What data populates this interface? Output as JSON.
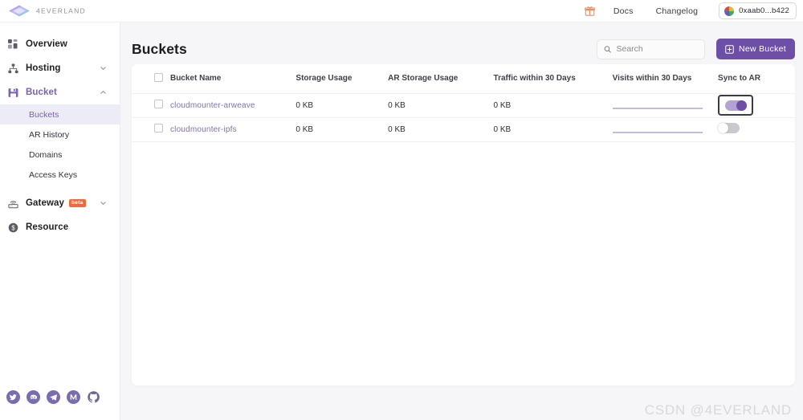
{
  "brand": {
    "name": "4EVERLAND",
    "logo_icon": "diamond-logo-icon"
  },
  "topbar": {
    "gift_icon": "gift-icon",
    "links": [
      {
        "label": "Docs",
        "name": "docs-link"
      },
      {
        "label": "Changelog",
        "name": "changelog-link"
      }
    ],
    "wallet": {
      "address": "0xaab0...b422",
      "avatar_icon": "wallet-avatar-icon"
    }
  },
  "sidebar": {
    "items": [
      {
        "label": "Overview",
        "icon": "grid-dashboard-icon",
        "expandable": false,
        "active": false
      },
      {
        "label": "Hosting",
        "icon": "sitemap-network-icon",
        "expandable": true,
        "expanded": false,
        "active": false
      },
      {
        "label": "Bucket",
        "icon": "floppy-save-icon",
        "expandable": true,
        "expanded": true,
        "active": true
      },
      {
        "label": "Gateway",
        "icon": "router-wifi-icon",
        "expandable": true,
        "expanded": false,
        "active": false,
        "badge": "beta"
      },
      {
        "label": "Resource",
        "icon": "dollar-coin-icon",
        "expandable": false,
        "active": false
      }
    ],
    "bucket_subitems": [
      {
        "label": "Buckets",
        "selected": true
      },
      {
        "label": "AR History",
        "selected": false
      },
      {
        "label": "Domains",
        "selected": false
      },
      {
        "label": "Access Keys",
        "selected": false
      }
    ],
    "socials": [
      {
        "name": "twitter-icon"
      },
      {
        "name": "discord-icon"
      },
      {
        "name": "telegram-icon"
      },
      {
        "name": "medium-icon"
      },
      {
        "name": "github-icon"
      }
    ]
  },
  "main": {
    "title": "Buckets",
    "search": {
      "placeholder": "Search",
      "value": "",
      "icon": "search-icon"
    },
    "new_bucket": {
      "label": "New Bucket",
      "icon": "add-box-icon"
    },
    "table": {
      "columns": [
        "Bucket Name",
        "Storage Usage",
        "AR Storage Usage",
        "Traffic within 30 Days",
        "Visits within 30 Days",
        "Sync to AR"
      ],
      "rows": [
        {
          "name": "cloudmounter-arweave",
          "storage_usage": "0 KB",
          "ar_storage_usage": "0 KB",
          "traffic_30d": "0 KB",
          "visits_30d_sparkline": "flat-zero",
          "sync_to_ar": true,
          "sync_focused": true,
          "checked": false
        },
        {
          "name": "cloudmounter-ipfs",
          "storage_usage": "0 KB",
          "ar_storage_usage": "0 KB",
          "traffic_30d": "0 KB",
          "visits_30d_sparkline": "flat-zero",
          "sync_to_ar": false,
          "sync_focused": false,
          "checked": false
        }
      ]
    }
  },
  "watermark": "CSDN @4EVERLAND",
  "colors": {
    "accent_purple": "#6d4fa8",
    "link_purple": "#8071ad",
    "selected_bg": "#ececf6",
    "beta_orange": "#f4693b",
    "page_bg": "#f6f6f8"
  }
}
